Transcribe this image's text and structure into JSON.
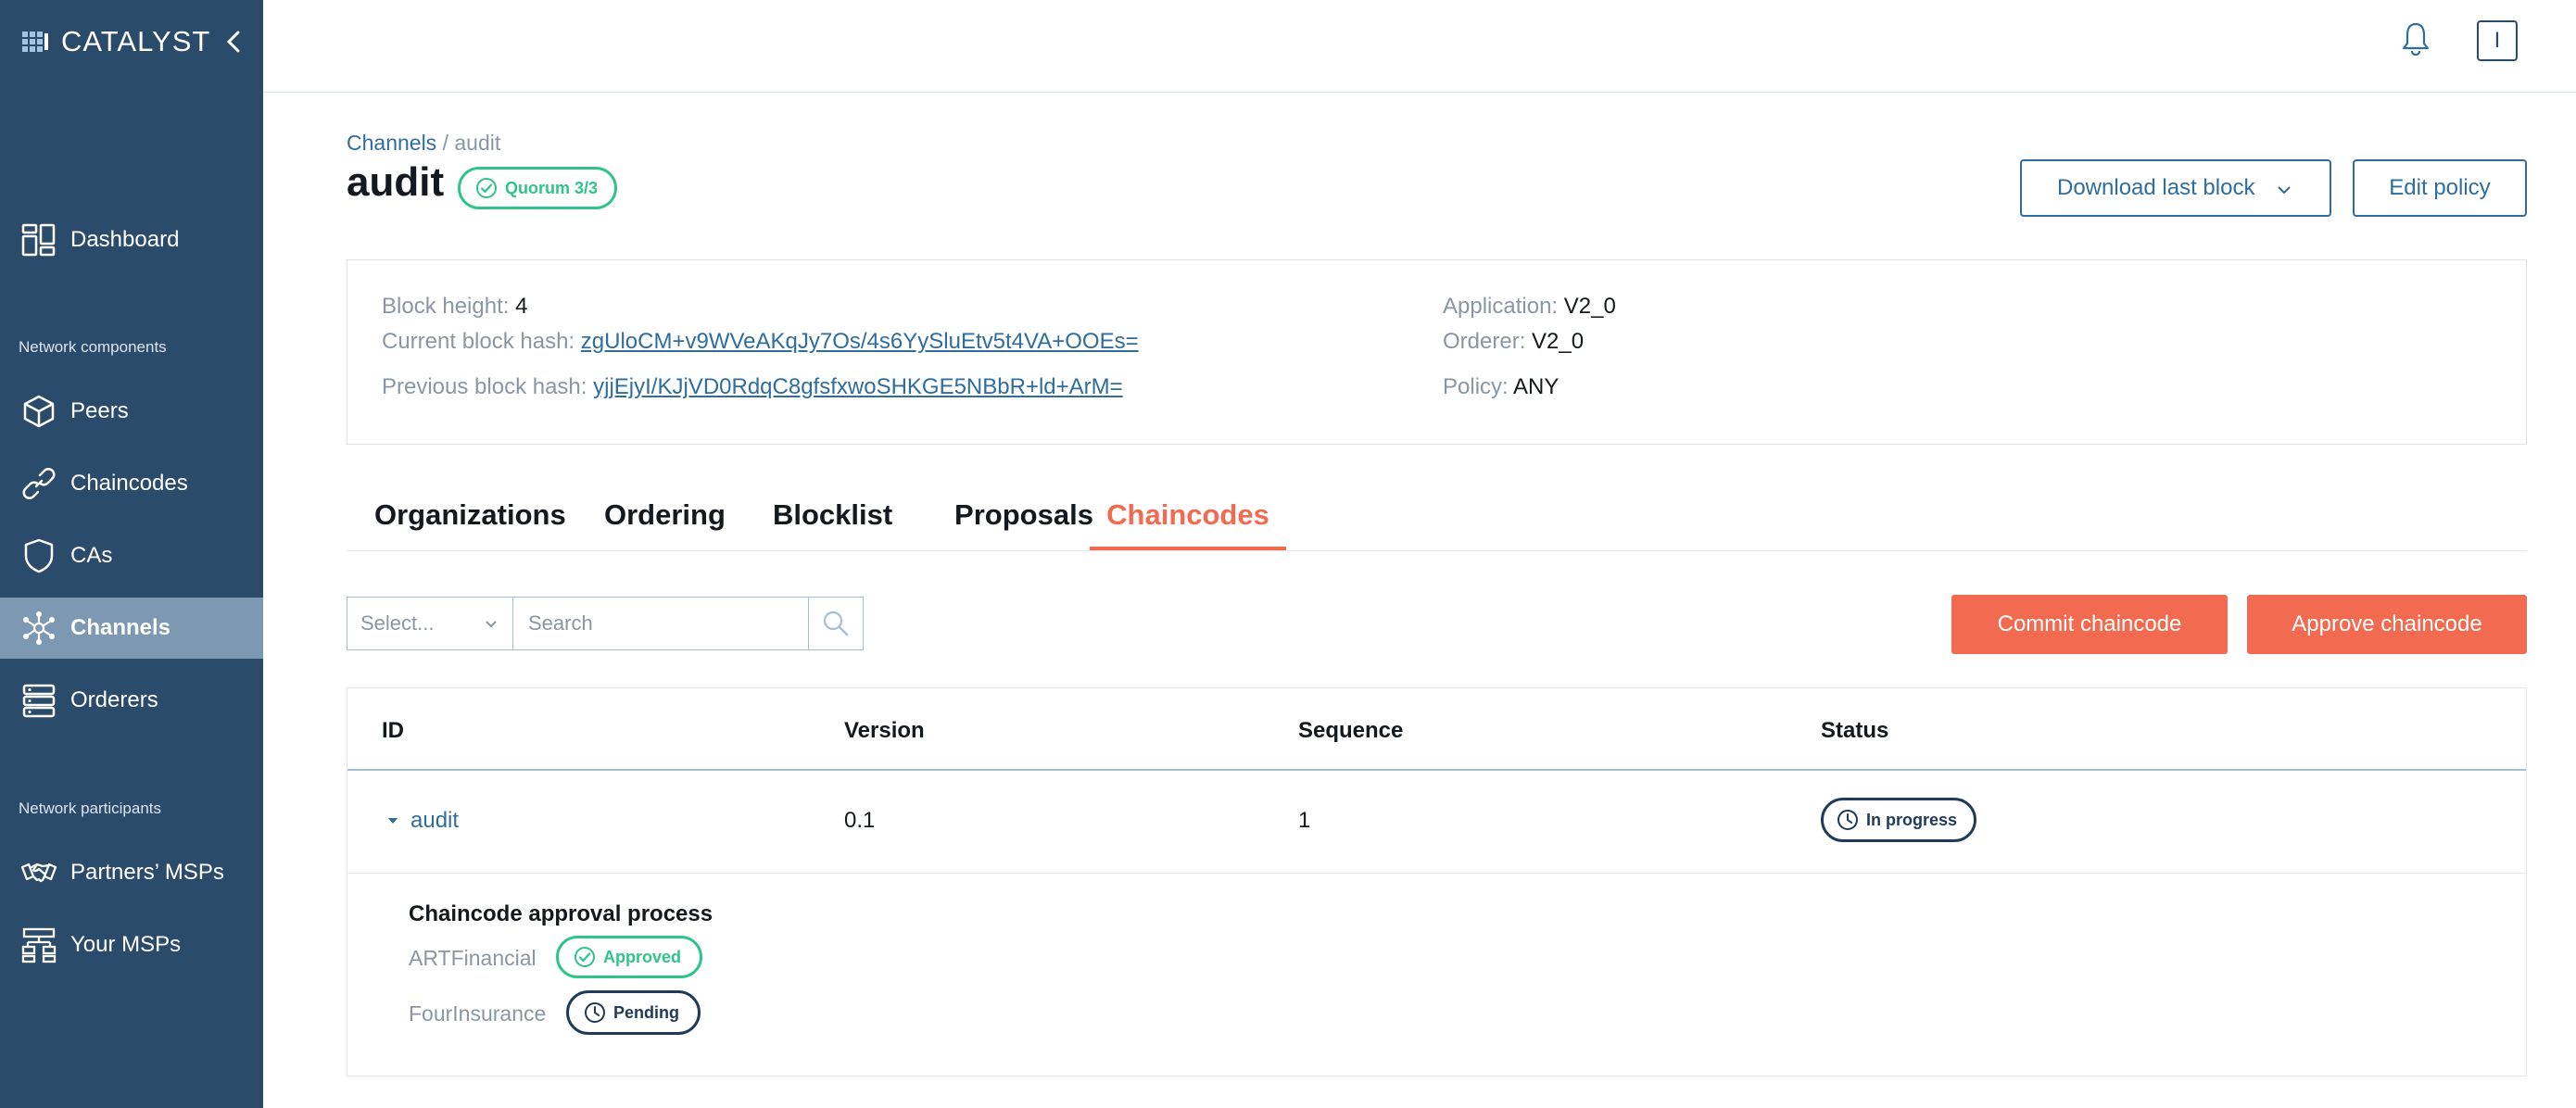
{
  "brand": {
    "name": "CATALYST"
  },
  "sidebar": {
    "items": [
      {
        "label": "Dashboard",
        "icon": "dashboard-icon"
      },
      {
        "label": "Peers",
        "icon": "cube-icon"
      },
      {
        "label": "Chaincodes",
        "icon": "link-icon"
      },
      {
        "label": "CAs",
        "icon": "shield-icon"
      },
      {
        "label": "Channels",
        "icon": "network-icon",
        "active": true
      },
      {
        "label": "Orderers",
        "icon": "server-icon"
      },
      {
        "label": "Partners’ MSPs",
        "icon": "handshake-icon"
      },
      {
        "label": "Your MSPs",
        "icon": "org-chart-icon"
      }
    ],
    "sections": {
      "components": "Network components",
      "participants": "Network participants"
    }
  },
  "topbar": {
    "user_initial": "I"
  },
  "breadcrumb": {
    "parent": "Channels",
    "separator": " / ",
    "current": "audit"
  },
  "page": {
    "title": "audit",
    "quorum_badge": "Quorum 3/3",
    "download_label": "Download last block",
    "edit_policy_label": "Edit policy"
  },
  "info": {
    "block_height_label": "Block height:",
    "block_height": "4",
    "current_hash_label": "Current block hash:",
    "current_hash": "zgUloCM+v9WVeAKqJy7Os/4s6YySluEtv5t4VA+OOEs=",
    "previous_hash_label": "Previous block hash:",
    "previous_hash": "yjjEjyI/KJjVD0RdqC8gfsfxwoSHKGE5NBbR+ld+ArM=",
    "application_label": "Application:",
    "application": "V2_0",
    "orderer_label": "Orderer:",
    "orderer": "V2_0",
    "policy_label": "Policy:",
    "policy": "ANY"
  },
  "tabs": [
    "Organizations",
    "Ordering",
    "Blocklist",
    "Proposals",
    "Chaincodes"
  ],
  "active_tab": "Chaincodes",
  "filter": {
    "select_placeholder": "Select...",
    "search_placeholder": "Search"
  },
  "actions": {
    "commit": "Commit chaincode",
    "approve": "Approve chaincode"
  },
  "table": {
    "columns": [
      "ID",
      "Version",
      "Sequence",
      "Status"
    ],
    "rows": [
      {
        "id": "audit",
        "version": "0.1",
        "sequence": "1",
        "status": "In progress"
      }
    ]
  },
  "approval": {
    "title": "Chaincode approval process",
    "orgs": [
      {
        "name": "ARTFinancial",
        "status": "Approved"
      },
      {
        "name": "FourInsurance",
        "status": "Pending"
      }
    ]
  },
  "colors": {
    "sidebar_bg": "#2b4b6b",
    "sidebar_active": "#7d98b3",
    "accent": "#f26b50",
    "link": "#2e6d9e",
    "success": "#2fc48a",
    "navy": "#1f3b5a"
  }
}
